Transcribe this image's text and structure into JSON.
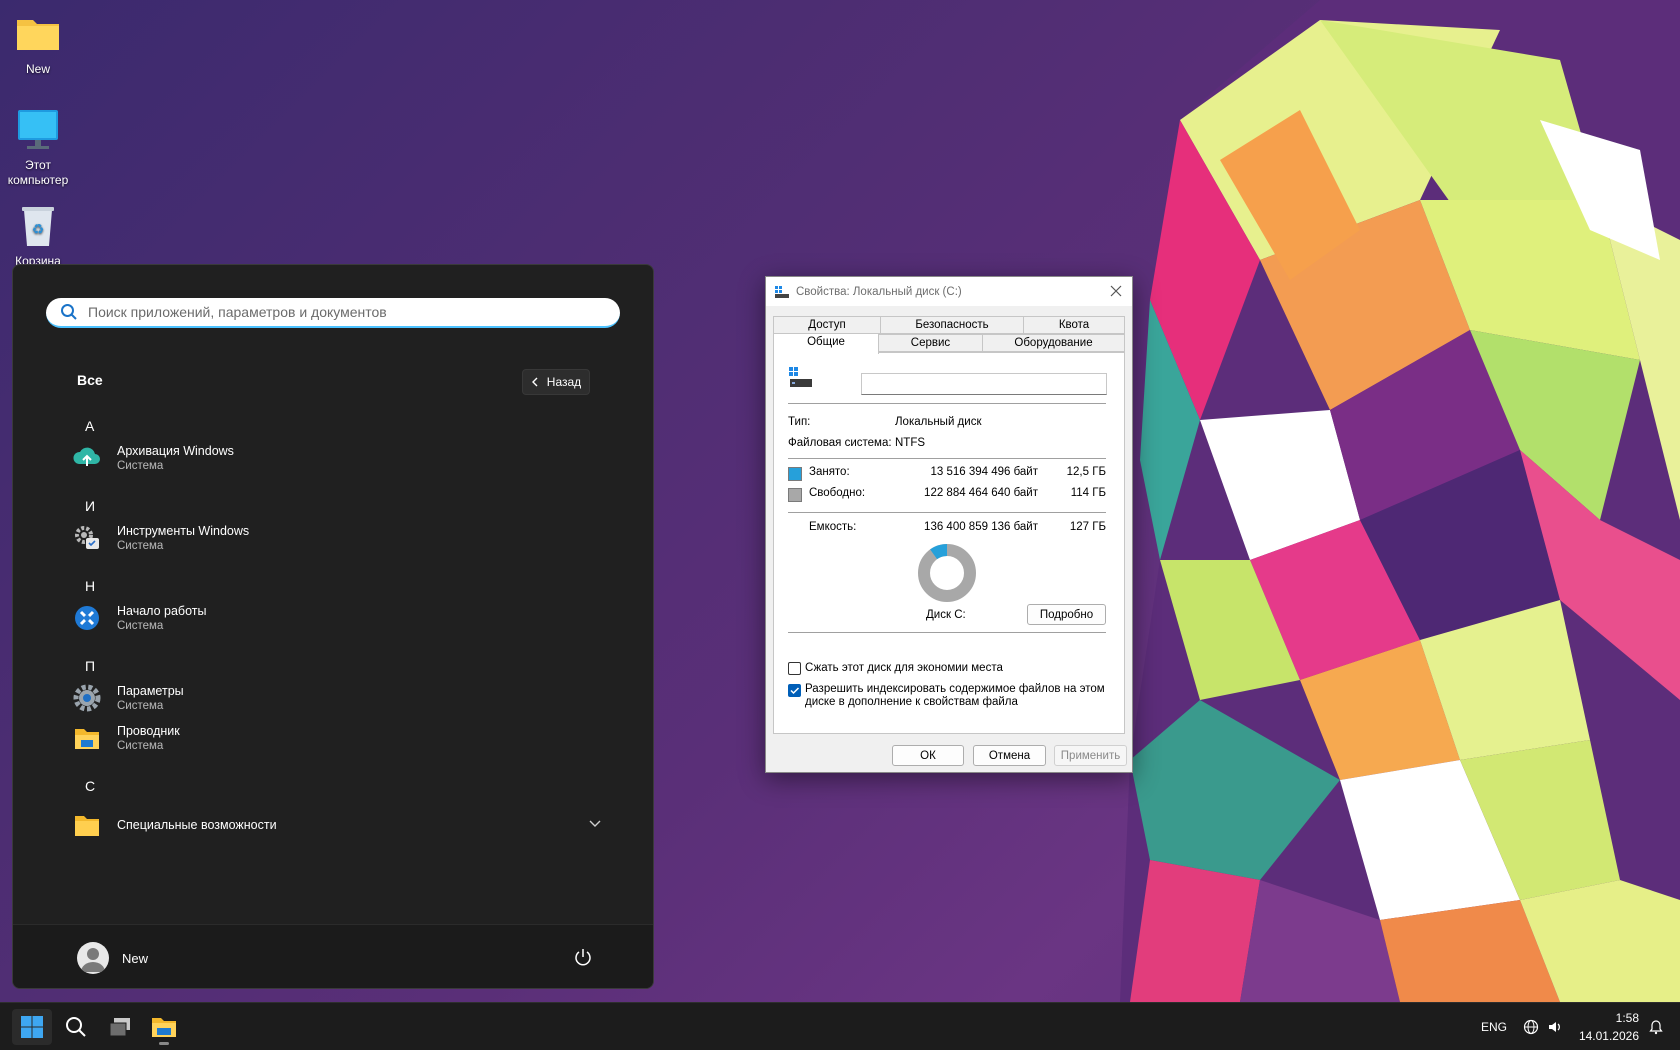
{
  "desktop": {
    "icons": [
      {
        "label": "New"
      },
      {
        "label": "Этот компьютер"
      },
      {
        "label": "Корзина"
      }
    ]
  },
  "start_menu": {
    "search_placeholder": "Поиск приложений, параметров и документов",
    "all_label": "Все",
    "back_label": "Назад",
    "groups": [
      {
        "letter": "А"
      },
      {
        "letter": "И"
      },
      {
        "letter": "Н"
      },
      {
        "letter": "П"
      },
      {
        "letter": "С"
      }
    ],
    "apps": [
      {
        "name": "Архивация Windows",
        "sub": "Система",
        "icon": "backup-icon"
      },
      {
        "name": "Инструменты Windows",
        "sub": "Система",
        "icon": "windows-tools-icon"
      },
      {
        "name": "Начало работы",
        "sub": "Система",
        "icon": "get-started-icon"
      },
      {
        "name": "Параметры",
        "sub": "Система",
        "icon": "settings-gear-icon"
      },
      {
        "name": "Проводник",
        "sub": "Система",
        "icon": "file-explorer-icon"
      },
      {
        "name": "Специальные возможности",
        "sub": "",
        "icon": "folder-icon"
      }
    ],
    "user_name": "New"
  },
  "dialog": {
    "title": "Свойства: Локальный диск (C:)",
    "tabs_top": [
      "Доступ",
      "Безопасность",
      "Квота"
    ],
    "tabs_bottom": [
      "Общие",
      "Сервис",
      "Оборудование"
    ],
    "active_tab": "Общие",
    "name_value": "",
    "type_label": "Тип:",
    "type_value": "Локальный диск",
    "fs_label": "Файловая система:",
    "fs_value": "NTFS",
    "used_label": "Занято:",
    "used_bytes": "13 516 394 496 байт",
    "used_size": "12,5 ГБ",
    "free_label": "Свободно:",
    "free_bytes": "122 884 464 640 байт",
    "free_size": "114 ГБ",
    "capacity_label": "Емкость:",
    "capacity_bytes": "136 400 859 136 байт",
    "capacity_size": "127 ГБ",
    "used_fraction": 0.099,
    "disk_label": "Диск С:",
    "details_button": "Подробно",
    "compress_label": "Сжать этот диск для экономии места",
    "compress_checked": false,
    "index_label": "Разрешить индексировать содержимое файлов на этом диске в дополнение к свойствам файла",
    "index_checked": true,
    "ok_button": "ОК",
    "cancel_button": "Отмена",
    "apply_button": "Применить",
    "colors": {
      "used": "#26a0da",
      "free": "#a8a8a8"
    }
  },
  "taskbar": {
    "language": "ENG",
    "time": "1:58",
    "date": "14.01.2026"
  }
}
